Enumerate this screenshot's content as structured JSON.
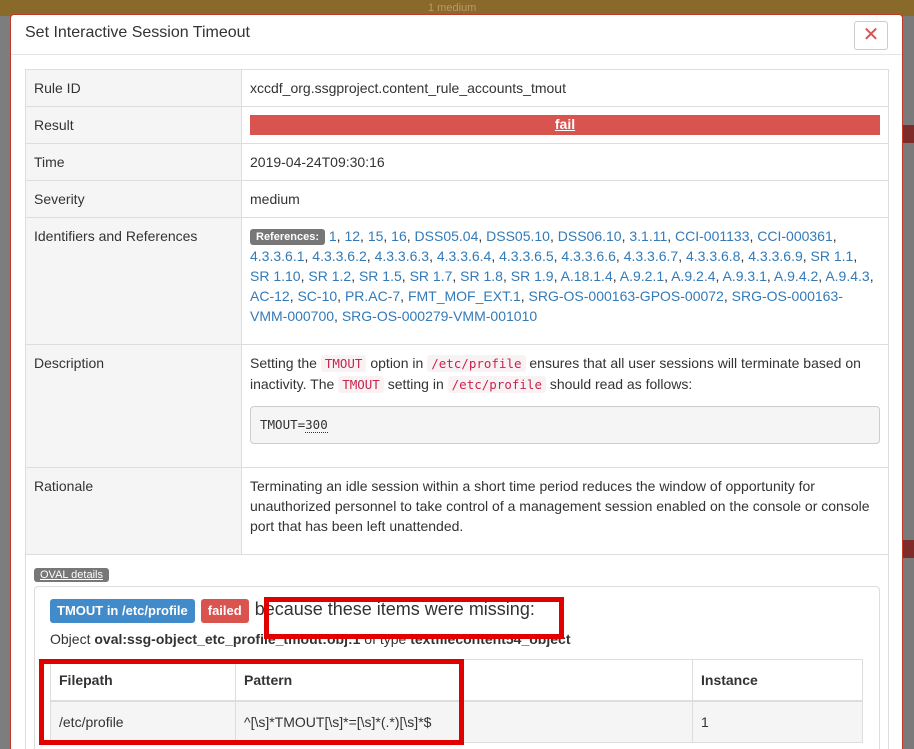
{
  "backdrop": {
    "topbar_text": "1 medium"
  },
  "modal": {
    "title": "Set Interactive Session Timeout",
    "close_glyph": "✕"
  },
  "rows": {
    "rule_id": {
      "key": "Rule ID",
      "value": "xccdf_org.ssgproject.content_rule_accounts_tmout"
    },
    "result": {
      "key": "Result",
      "value": "fail"
    },
    "time": {
      "key": "Time",
      "value": "2019-04-24T09:30:16"
    },
    "severity": {
      "key": "Severity",
      "value": "medium"
    },
    "identifiers": {
      "key": "Identifiers and References",
      "references_label": "References:",
      "references": [
        "1",
        "12",
        "15",
        "16",
        "DSS05.04",
        "DSS05.10",
        "DSS06.10",
        "3.1.11",
        "CCI-001133",
        "CCI-000361",
        "4.3.3.6.1",
        "4.3.3.6.2",
        "4.3.3.6.3",
        "4.3.3.6.4",
        "4.3.3.6.5",
        "4.3.3.6.6",
        "4.3.3.6.7",
        "4.3.3.6.8",
        "4.3.3.6.9",
        "SR 1.1",
        "SR 1.10",
        "SR 1.2",
        "SR 1.5",
        "SR 1.7",
        "SR 1.8",
        "SR 1.9",
        "A.18.1.4",
        "A.9.2.1",
        "A.9.2.4",
        "A.9.3.1",
        "A.9.4.2",
        "A.9.4.3",
        "AC-12",
        "SC-10",
        "PR.AC-7",
        "FMT_MOF_EXT.1",
        "SRG-OS-000163-GPOS-00072",
        "SRG-OS-000163-VMM-000700",
        "SRG-OS-000279-VMM-001010"
      ]
    },
    "description": {
      "key": "Description",
      "t1": "Setting the ",
      "code1": "TMOUT",
      "t2": " option in ",
      "code2": "/etc/profile",
      "t3": " ensures that all user sessions will terminate based on inactivity. The ",
      "code3": "TMOUT",
      "t4": " setting in ",
      "code4": "/etc/profile",
      "t5": " should read as follows:",
      "code_prefix": "TMOUT=",
      "code_value": "300"
    },
    "rationale": {
      "key": "Rationale",
      "value": "Terminating an idle session within a short time period reduces the window of opportunity for unauthorized personnel to take control of a management session enabled on the console or console port that has been left unattended."
    }
  },
  "oval": {
    "label": "OVAL details",
    "test_label": "TMOUT in /etc/profile",
    "status_label": "failed",
    "missing_text": "because these items were missing:",
    "object_prefix": "Object ",
    "object_id": "oval:ssg-object_etc_profile_tmout:obj:1",
    "object_mid": " of type ",
    "object_type": "textfilecontent54_object",
    "table": {
      "headers": [
        "Filepath",
        "Pattern",
        "Instance"
      ],
      "row": [
        "/etc/profile",
        "^[\\s]*TMOUT[\\s]*=[\\s]*(.*)[\\s]*$",
        "1"
      ]
    }
  },
  "colors": {
    "fail": "#d9534f",
    "link": "#337ab7",
    "highlight": "#e00000"
  }
}
